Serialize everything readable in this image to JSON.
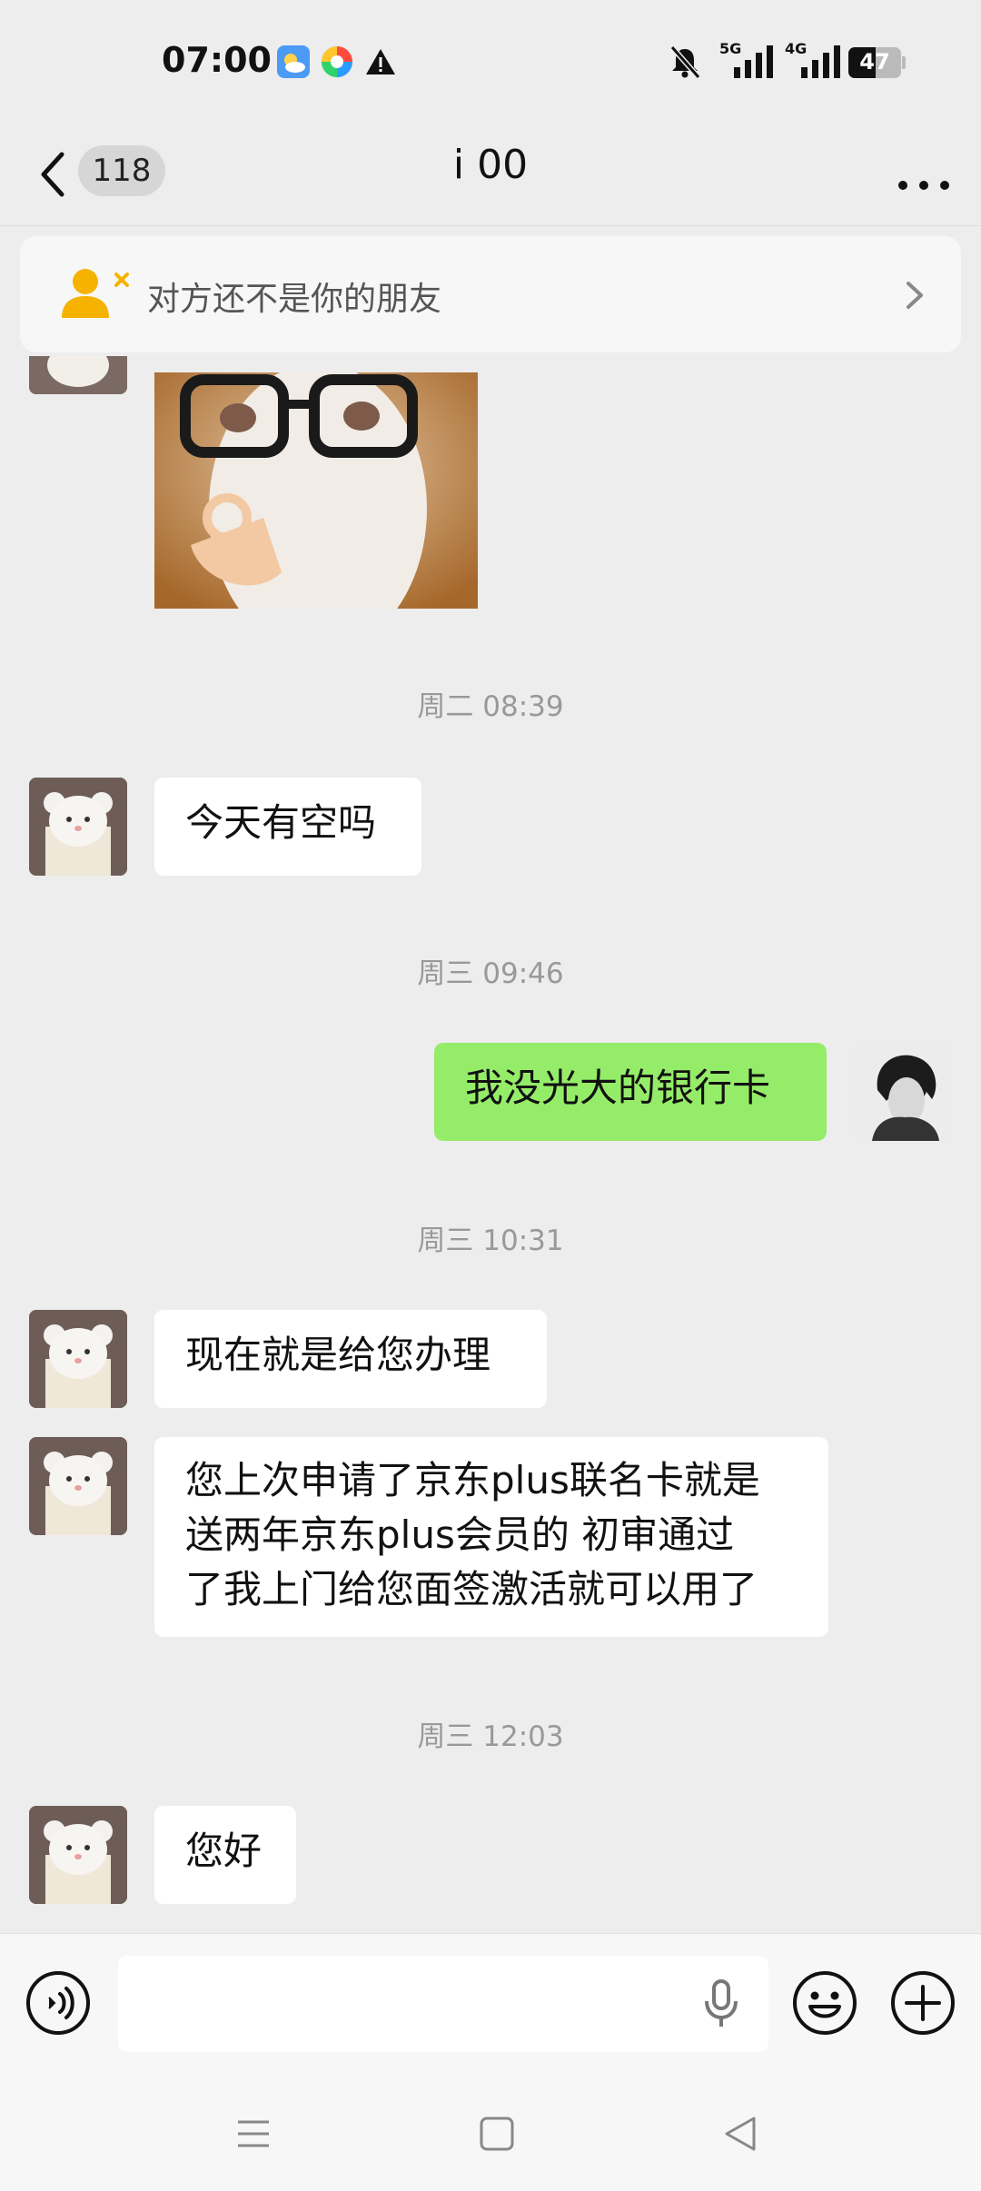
{
  "status_bar": {
    "time": "07:00",
    "battery": "47",
    "signal_1": "5G",
    "signal_2": "4G"
  },
  "header": {
    "back_count": "118",
    "title": "i 00"
  },
  "banner": {
    "text": "对方还不是你的朋友"
  },
  "messages": [
    {
      "type": "timestamp",
      "text": "周二 08:39"
    },
    {
      "type": "incoming",
      "text": "今天有空吗"
    },
    {
      "type": "timestamp",
      "text": "周三 09:46"
    },
    {
      "type": "outgoing",
      "text": "我没光大的银行卡"
    },
    {
      "type": "timestamp",
      "text": "周三 10:31"
    },
    {
      "type": "incoming",
      "text": "现在就是给您办理"
    },
    {
      "type": "incoming",
      "lines": [
        "您上次申请了京东plus联名卡就是",
        "送两年京东plus会员的 初审通过",
        "了我上门给您面签激活就可以用了"
      ]
    },
    {
      "type": "timestamp",
      "text": "周三 12:03"
    },
    {
      "type": "incoming",
      "text": "您好"
    }
  ],
  "input": {
    "placeholder": ""
  },
  "colors": {
    "background": "#ededed",
    "outgoing_bubble": "#95ec69",
    "incoming_bubble": "#ffffff",
    "stranger_icon": "#f5b300"
  },
  "icons": [
    "voice-toggle-icon",
    "mic-icon",
    "emoji-icon",
    "plus-icon",
    "back-icon",
    "more-icon",
    "stranger-icon",
    "chevron-right-icon"
  ]
}
